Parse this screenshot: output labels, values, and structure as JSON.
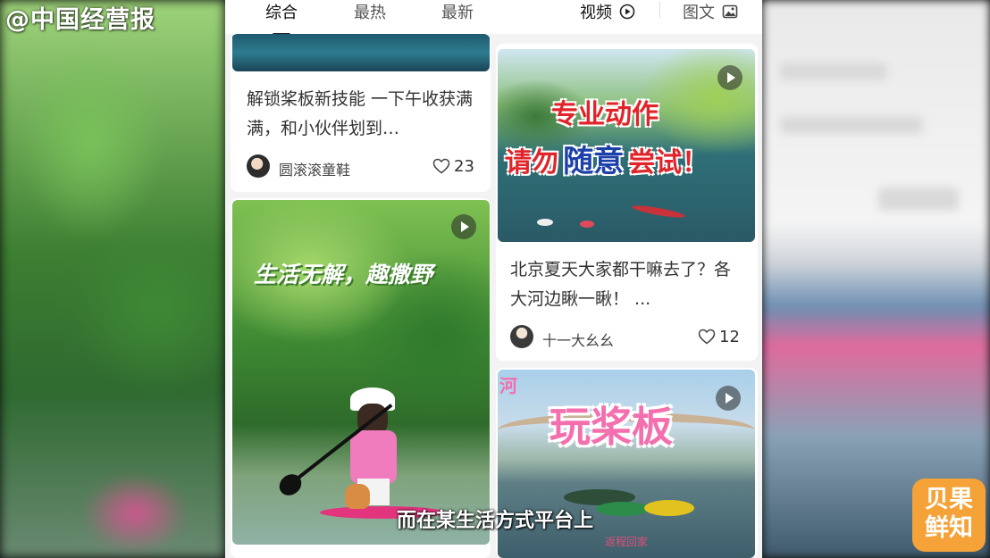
{
  "watermark": "@中国经营报",
  "tabs": [
    {
      "label": "综合"
    },
    {
      "label": "最热"
    },
    {
      "label": "最新"
    },
    {
      "label": "视频"
    },
    {
      "label": "图文"
    }
  ],
  "posts": [
    {
      "text": "解锁桨板新技能 一下午收获满满，和小伙伴划到…",
      "author": "圆滚滚童鞋",
      "likes": "23"
    },
    {
      "overlay": [
        "专业动作",
        "请勿",
        "随意",
        "尝试！"
      ],
      "text": "北京夏天大家都干嘛去了？各大河边瞅一瞅！ ...",
      "author": "十一大幺幺",
      "likes": "12"
    },
    {
      "overlay": [
        "生活无解，趣撒野"
      ]
    },
    {
      "overlay": [
        "河",
        "玩桨板",
        "返程回家"
      ]
    }
  ],
  "subtitle": "而在某生活方式平台上",
  "logo": [
    "贝果",
    "鲜知"
  ],
  "colors": {
    "accent_red": "#e0242a",
    "logo_orange": "#f5a238",
    "overlay_pink": "#f36fae"
  }
}
